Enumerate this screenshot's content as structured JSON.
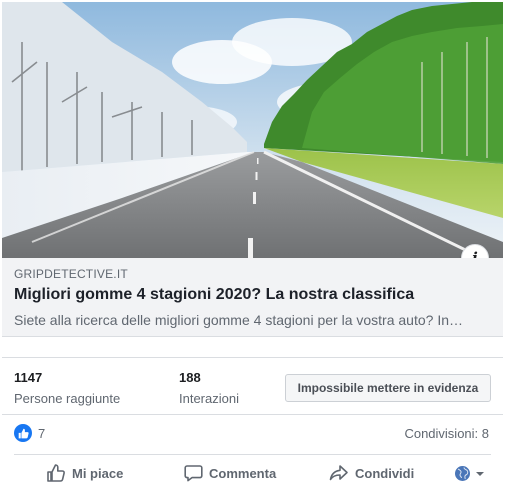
{
  "hero": {
    "icon": "road-winter-summer-image"
  },
  "link": {
    "domain": "GRIPDETECTIVE.IT",
    "headline": "Migliori gomme 4 stagioni 2020? La nostra classifica",
    "description": "Siete alla ricerca delle migliori gomme 4 stagioni per la vostra auto? In…"
  },
  "stats": {
    "reach_value": "1147",
    "reach_label": "Persone raggiunte",
    "interactions_value": "188",
    "interactions_label": "Interazioni",
    "boost_label": "Impossibile mettere in evidenza"
  },
  "engagement": {
    "reactions_count": "7",
    "shares_text": "Condivisioni: 8"
  },
  "actions": {
    "like_label": "Mi piace",
    "comment_label": "Commenta",
    "share_label": "Condividi"
  },
  "colors": {
    "accent": "#1877f2",
    "meta_background": "#f2f3f5",
    "secondary_text": "#606770"
  }
}
